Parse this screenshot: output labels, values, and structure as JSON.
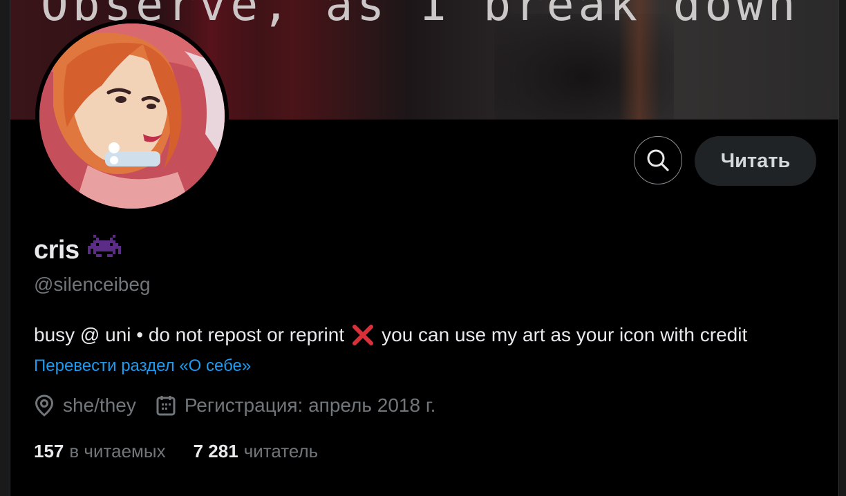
{
  "banner": {
    "text": "Observe, as I break down"
  },
  "profile": {
    "display_name": "cris",
    "name_emoji_icon": "space-invader-icon",
    "handle": "@silenceibeg",
    "bio_before": "busy @ uni • do not repost or reprint",
    "bio_icon": "cross-mark-icon",
    "bio_after": "you can use my art as your icon with credit",
    "translate_link": "Перевести раздел «О себе»",
    "location_icon": "location-pin-icon",
    "location": "she/they",
    "joined_icon": "calendar-icon",
    "joined": "Регистрация: апрель 2018 г."
  },
  "actions": {
    "search_icon": "search-icon",
    "follow_label": "Читать"
  },
  "stats": {
    "following_count": "157",
    "following_label": "в читаемых",
    "followers_count": "7 281",
    "followers_label": "читатель"
  },
  "colors": {
    "background": "#000000",
    "text_primary": "#e7e9ea",
    "text_secondary": "#71767b",
    "link": "#1d9bf0",
    "follow_button_bg": "#1f2326",
    "emoji_purple": "#5b2d86",
    "cross_red": "#d9303a"
  }
}
